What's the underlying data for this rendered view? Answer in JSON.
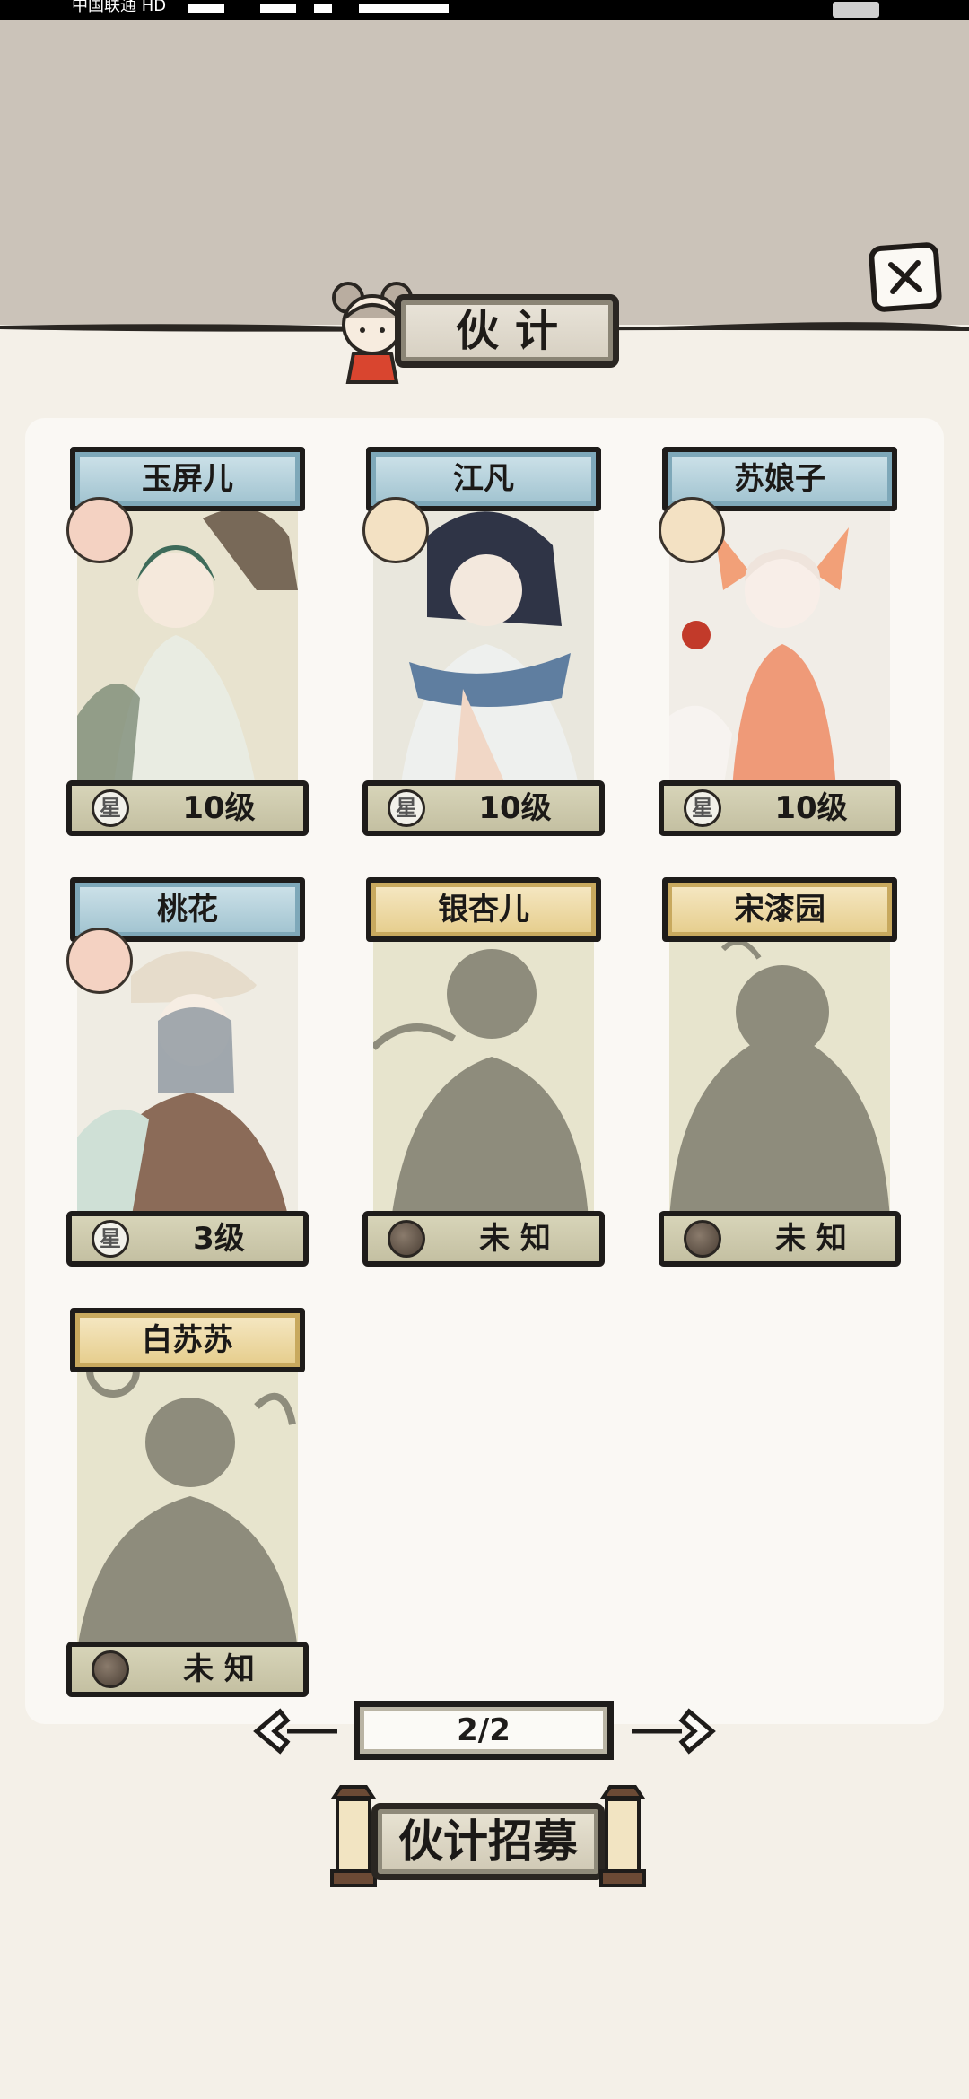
{
  "status_bar": {
    "carrier": "中国联通 HD"
  },
  "header": {
    "title": "伙计"
  },
  "partners": [
    {
      "name": "玉屏儿",
      "level": "10级",
      "unlocked": true,
      "mood": "happy"
    },
    {
      "name": "江凡",
      "level": "10级",
      "unlocked": true,
      "mood": "neutral"
    },
    {
      "name": "苏娘子",
      "level": "10级",
      "unlocked": true,
      "mood": "neutral"
    },
    {
      "name": "桃花",
      "level": "3级",
      "unlocked": true,
      "mood": "happy"
    },
    {
      "name": "银杏儿",
      "level": "未 知",
      "unlocked": false
    },
    {
      "name": "宋漆园",
      "level": "未 知",
      "unlocked": false
    },
    {
      "name": "白苏苏",
      "level": "未 知",
      "unlocked": false
    }
  ],
  "level_emblem_glyph": "星",
  "pagination": {
    "label": "2/2"
  },
  "recruit_button": {
    "label": "伙计招募"
  },
  "colors": {
    "top_band": "#cbc3b9",
    "background": "#f4f0e8",
    "panel": "#faf8f4",
    "unlocked_name_bar": "#9fc2cf",
    "locked_name_bar": "#e5cc8a",
    "silhouette": "#8e8c7c"
  }
}
